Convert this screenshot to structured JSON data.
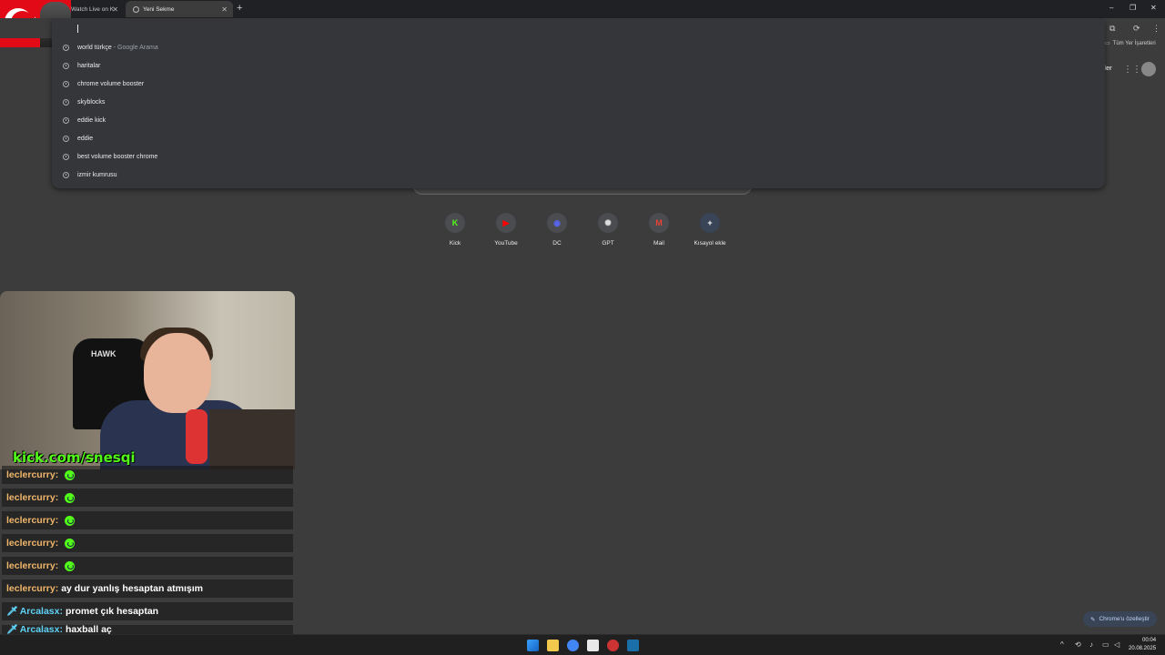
{
  "browser": {
    "tabs": [
      {
        "label": "Watch Live on K",
        "active": false
      },
      {
        "label": "Yeni Sekme",
        "active": true
      }
    ],
    "bookmarks_label": "Tüm Yer İşaretleri",
    "header_cut": "ler"
  },
  "omnibox": {
    "value": "",
    "suggestions": [
      {
        "text": "world türkçe",
        "suffix": "- Google Arama"
      },
      {
        "text": "haritalar",
        "suffix": ""
      },
      {
        "text": "chrome volume booster",
        "suffix": ""
      },
      {
        "text": "skyblocks",
        "suffix": ""
      },
      {
        "text": "eddie kick",
        "suffix": ""
      },
      {
        "text": "eddie",
        "suffix": ""
      },
      {
        "text": "best volume booster chrome",
        "suffix": ""
      },
      {
        "text": "izmir kumrusu",
        "suffix": ""
      }
    ]
  },
  "shortcuts": [
    {
      "label": "Kick",
      "glyph": "K",
      "color": "#53fc18"
    },
    {
      "label": "YouTube",
      "glyph": "▶",
      "color": "#ff0000"
    },
    {
      "label": "DC",
      "glyph": "◉",
      "color": "#5865f2"
    },
    {
      "label": "GPT",
      "glyph": "✺",
      "color": "#dddddd"
    },
    {
      "label": "Mail",
      "glyph": "M",
      "color": "#ea4335"
    },
    {
      "label": "Kısayol ekle",
      "glyph": "+",
      "color": "#ffffff"
    }
  ],
  "stream": {
    "url_overlay": "kick.com/snesqi",
    "chair_text": "HAWK"
  },
  "chat": [
    {
      "user": "leclercurry:",
      "message": "",
      "emote": true,
      "badge": false
    },
    {
      "user": "leclercurry:",
      "message": "",
      "emote": true,
      "badge": false
    },
    {
      "user": "leclercurry:",
      "message": "",
      "emote": true,
      "badge": false
    },
    {
      "user": "leclercurry:",
      "message": "",
      "emote": true,
      "badge": false
    },
    {
      "user": "leclercurry:",
      "message": "",
      "emote": true,
      "badge": false
    },
    {
      "user": "leclercurry:",
      "message": "ay dur yanlış hesaptan atmışım",
      "emote": false,
      "badge": false
    },
    {
      "user": "Arcalasx:",
      "message": "promet çık hesaptan",
      "emote": false,
      "badge": true
    },
    {
      "user": "Arcalasx:",
      "message": "haxball aç",
      "emote": false,
      "badge": true
    }
  ],
  "customize_label": "Chrome'u özelleştir",
  "taskbar": {
    "time": "00:04",
    "date": "20.08.2025"
  },
  "colors": {
    "kick_green": "#53fc18",
    "chat_user": "#f0b66a",
    "chat_user_blue": "#5fd2f5"
  }
}
